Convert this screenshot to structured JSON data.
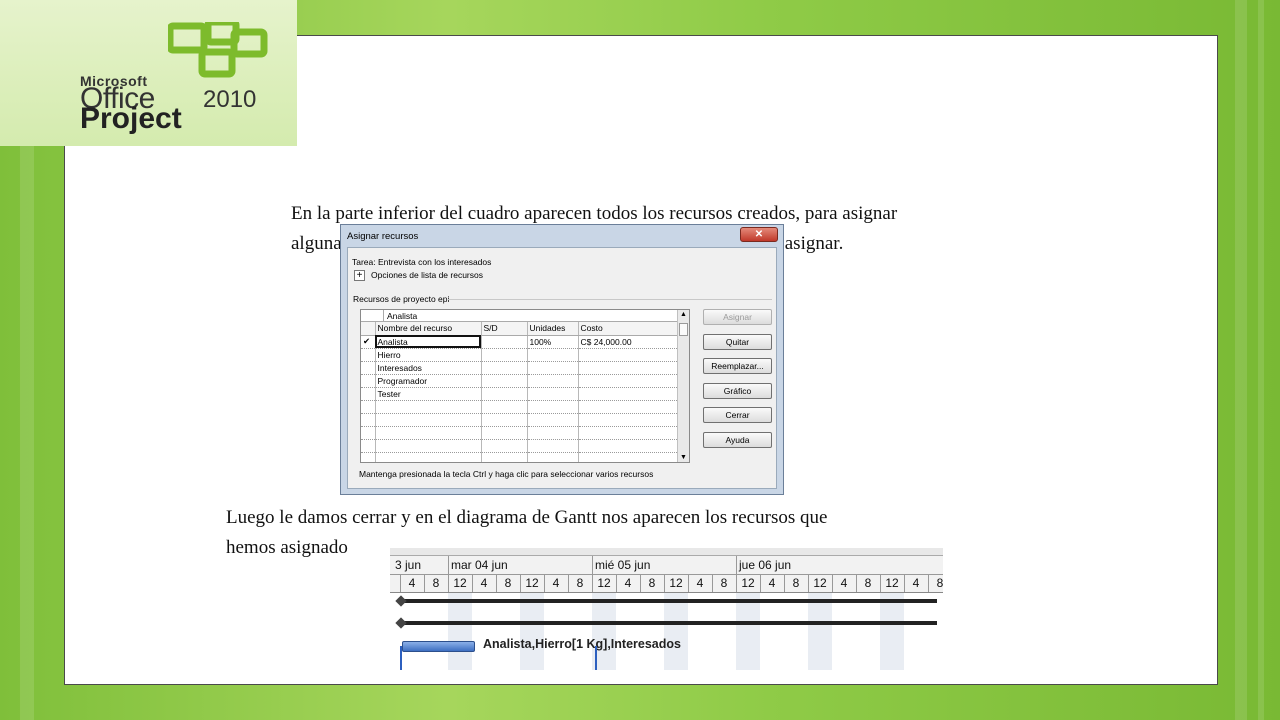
{
  "logo": {
    "microsoft": "Microsoft",
    "office": "Office",
    "year": "2010",
    "project": "Project",
    "accent": "#7dbb2c"
  },
  "paragraphs": {
    "intro_line1": "En la parte inferior del cuadro aparecen todos los recursos creados, para asignar",
    "intro_line2": "alguna de ellas se debe  seleccionar el recurso necesario y clic en asignar.",
    "outro_line1": "Luego le damos cerrar y en el diagrama de Gantt nos aparecen los recursos que",
    "outro_line2": "hemos asignado"
  },
  "dialog": {
    "title": "Asignar recursos",
    "close_glyph": "✕",
    "task": "Tarea: Entrevista con los interesados",
    "options_toggle": "+",
    "options_label": "Opciones de lista de recursos",
    "group_label": "Recursos de proyecto epi",
    "edit_value": "Analista",
    "columns": {
      "name": "Nombre del recurso",
      "sd": "S/D",
      "units": "Unidades",
      "cost": "Costo"
    },
    "rows": [
      {
        "check": "✔",
        "name": "Analista",
        "sd": "",
        "units": "100%",
        "cost": "C$ 24,000.00"
      },
      {
        "check": "",
        "name": "Hierro",
        "sd": "",
        "units": "",
        "cost": ""
      },
      {
        "check": "",
        "name": "Interesados",
        "sd": "",
        "units": "",
        "cost": ""
      },
      {
        "check": "",
        "name": "Programador",
        "sd": "",
        "units": "",
        "cost": ""
      },
      {
        "check": "",
        "name": "Tester",
        "sd": "",
        "units": "",
        "cost": ""
      },
      {
        "check": "",
        "name": "",
        "sd": "",
        "units": "",
        "cost": ""
      },
      {
        "check": "",
        "name": "",
        "sd": "",
        "units": "",
        "cost": ""
      },
      {
        "check": "",
        "name": "",
        "sd": "",
        "units": "",
        "cost": ""
      },
      {
        "check": "",
        "name": "",
        "sd": "",
        "units": "",
        "cost": ""
      },
      {
        "check": "",
        "name": "",
        "sd": "",
        "units": "",
        "cost": ""
      }
    ],
    "buttons": {
      "assign": "Asignar",
      "remove": "Quitar",
      "replace": "Reemplazar...",
      "graph": "Gráfico",
      "close": "Cerrar",
      "help": "Ayuda"
    },
    "hint": "Mantenga presionada la tecla Ctrl y haga clic para seleccionar varios recursos",
    "scroll_up": "▲",
    "scroll_down": "▼"
  },
  "gantt": {
    "days": [
      "3 jun",
      "mar 04 jun",
      "mié 05 jun",
      "jue 06 jun"
    ],
    "ticks": [
      "4",
      "8",
      "12",
      "4",
      "8",
      "12",
      "4",
      "8",
      "12",
      "4",
      "8",
      "12",
      "4",
      "8",
      "12",
      "4",
      "8",
      "12",
      "4",
      "8",
      "12",
      "4",
      "8"
    ],
    "task_label": "Analista,Hierro[1 Kg],Interesados",
    "task_color": "#3e6fc2"
  }
}
